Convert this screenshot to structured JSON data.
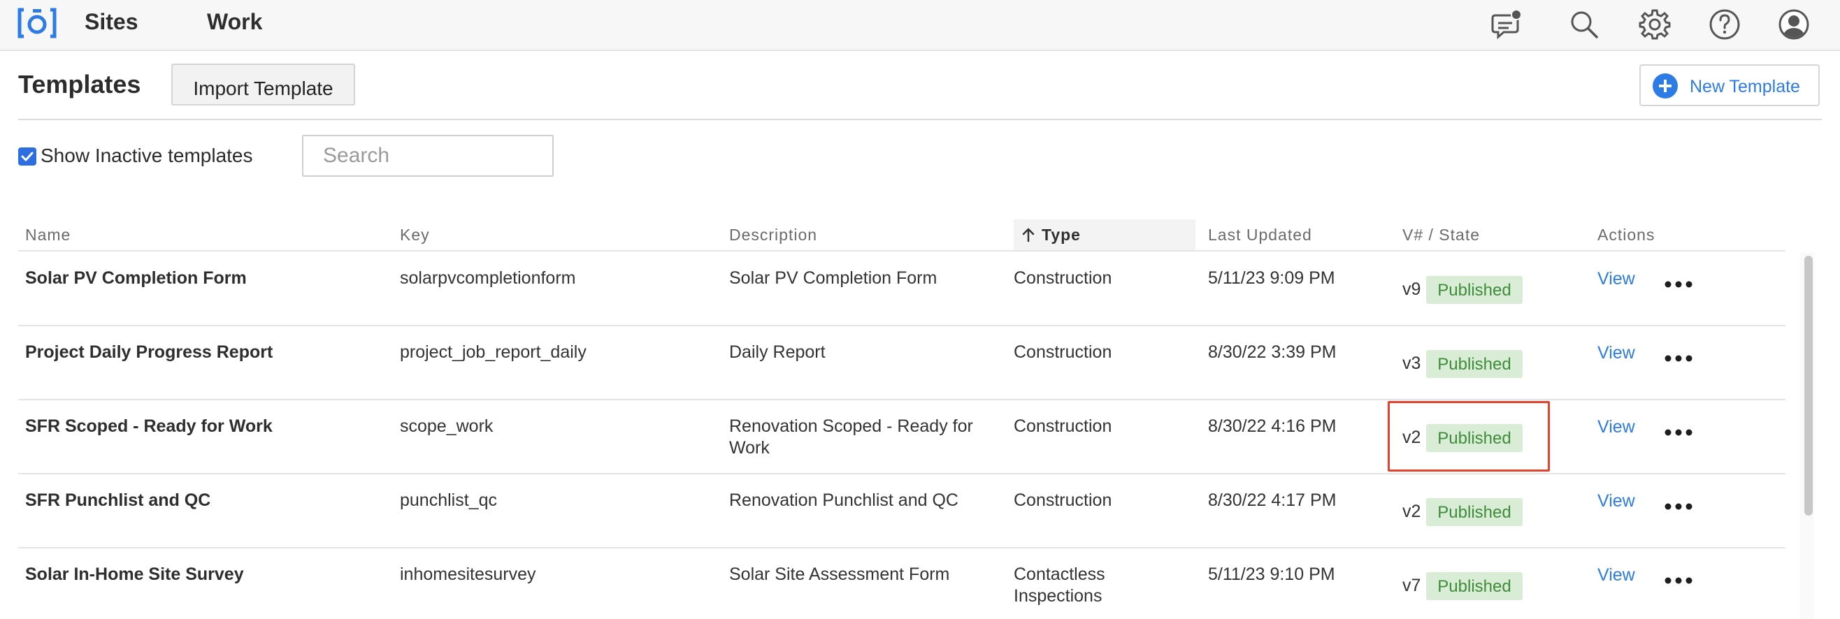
{
  "nav": {
    "logo": "brand-logo-icon",
    "items": [
      {
        "label": "Sites"
      },
      {
        "label": "Work"
      }
    ],
    "icons": [
      "chat-notification-icon",
      "search-icon",
      "gear-icon",
      "help-icon",
      "user-avatar-icon"
    ],
    "accent": "#2d7be5"
  },
  "header": {
    "title": "Templates",
    "import_label": "Import Template",
    "new_label": "New Template"
  },
  "filters": {
    "show_inactive_label": "Show Inactive templates",
    "show_inactive_checked": true,
    "search_placeholder": "Search",
    "search_value": ""
  },
  "table": {
    "columns": [
      "Name",
      "Key",
      "Description",
      "Type",
      "Last Updated",
      "V# / State",
      "Actions"
    ],
    "sorted_column": "Type",
    "sort_direction": "ascending",
    "rows": [
      {
        "name": "Solar PV Completion Form",
        "key": "solarpvcompletionform",
        "description": "Solar PV Completion Form",
        "type": "Construction",
        "updated": "5/11/23 9:09 PM",
        "version": "v9",
        "state": "Published",
        "action": "View"
      },
      {
        "name": "Project Daily Progress Report",
        "key": "project_job_report_daily",
        "description": "Daily Report",
        "type": "Construction",
        "updated": "8/30/22 3:39 PM",
        "version": "v3",
        "state": "Published",
        "action": "View"
      },
      {
        "name": "SFR Scoped - Ready for Work",
        "key": "scope_work",
        "description": "Renovation Scoped - Ready for Work",
        "type": "Construction",
        "updated": "8/30/22 4:16 PM",
        "version": "v2",
        "state": "Published",
        "action": "View",
        "highlighted": true
      },
      {
        "name": "SFR Punchlist and QC",
        "key": "punchlist_qc",
        "description": "Renovation Punchlist and QC",
        "type": "Construction",
        "updated": "8/30/22 4:17 PM",
        "version": "v2",
        "state": "Published",
        "action": "View"
      },
      {
        "name": "Solar In-Home Site Survey",
        "key": "inhomesitesurvey",
        "description": "Solar Site Assessment Form",
        "type": "Contactless Inspections",
        "updated": "5/11/23 9:10 PM",
        "version": "v7",
        "state": "Published",
        "action": "View"
      }
    ],
    "badge_colors": {
      "background": "#d9ecd6",
      "text": "#3f8c3a"
    },
    "highlight_color": "#e5412d"
  }
}
